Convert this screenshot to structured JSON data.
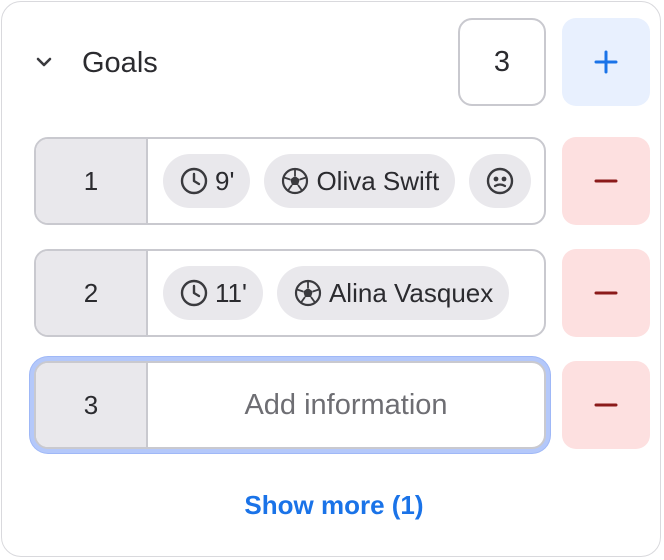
{
  "section": {
    "title": "Goals",
    "count": "3"
  },
  "goals": [
    {
      "index": "1",
      "time": "9'",
      "scorer": "Oliva Swift"
    },
    {
      "index": "2",
      "time": "11'",
      "scorer": "Alina Vasquex"
    },
    {
      "index": "3",
      "placeholder": "Add information"
    }
  ],
  "show_more_label": "Show more (1)",
  "icons": {
    "expand": "chevron-down-icon",
    "add": "plus-icon",
    "remove": "minus-icon",
    "time": "clock-icon",
    "scorer": "soccer-ball-icon",
    "assist": "face-icon"
  },
  "colors": {
    "accent": "#1a73e8",
    "add_bg": "#e8f0fe",
    "remove_bg": "#fde0e0",
    "remove_fg": "#8b1a1a",
    "chip_bg": "#e9e8ec",
    "focus_ring": "#b4c8fa"
  }
}
